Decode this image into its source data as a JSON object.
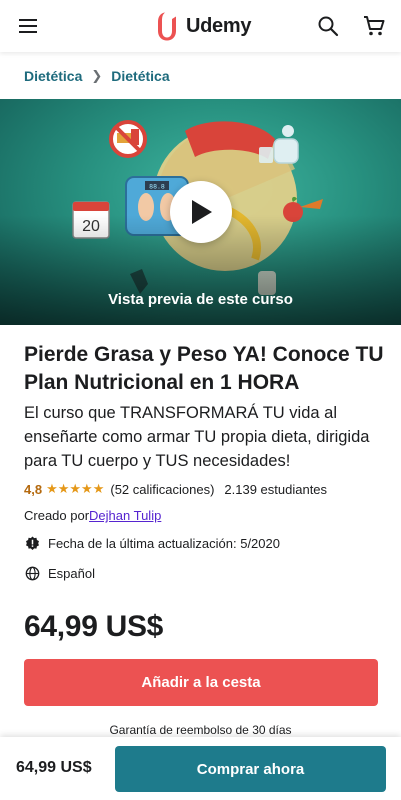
{
  "header": {
    "brand": "Udemy",
    "brand_color": "#a435f0",
    "logo_mark_color": "#ec5252",
    "icons": [
      "menu-icon",
      "search-icon",
      "cart-icon"
    ]
  },
  "breadcrumb": {
    "items": [
      "Dietética",
      "Dietética"
    ],
    "link_color": "#1e6b7d"
  },
  "preview": {
    "label": "Vista previa de este curso",
    "calendar_day": "20",
    "scale_reading": "88.8",
    "background_color": "#27907f"
  },
  "course": {
    "title": "Pierde Grasa y Peso YA! Conoce TU Plan Nutricional en 1 HORA",
    "subtitle": "El curso que TRANSFORMARÁ TU vida al enseñarte como armar TU propia dieta, dirigida para TU cuerpo y TUS necesidades!",
    "rating": "4,8",
    "stars": "★★★★★",
    "rating_count": "(52 calificaciones)",
    "students": "2.139 estudiantes",
    "created_by_label": "Creado por",
    "instructor": "Dejhan Tulip",
    "last_updated": "Fecha de la última actualización: 5/2020",
    "language": "Español",
    "price": "64,99 US$",
    "add_to_cart": "Añadir a la cesta",
    "guarantee": "Garantía de reembolso de 30 días"
  },
  "bottom_bar": {
    "price": "64,99 US$",
    "buy_now": "Comprar ahora",
    "buy_color": "#1e7b8c"
  }
}
